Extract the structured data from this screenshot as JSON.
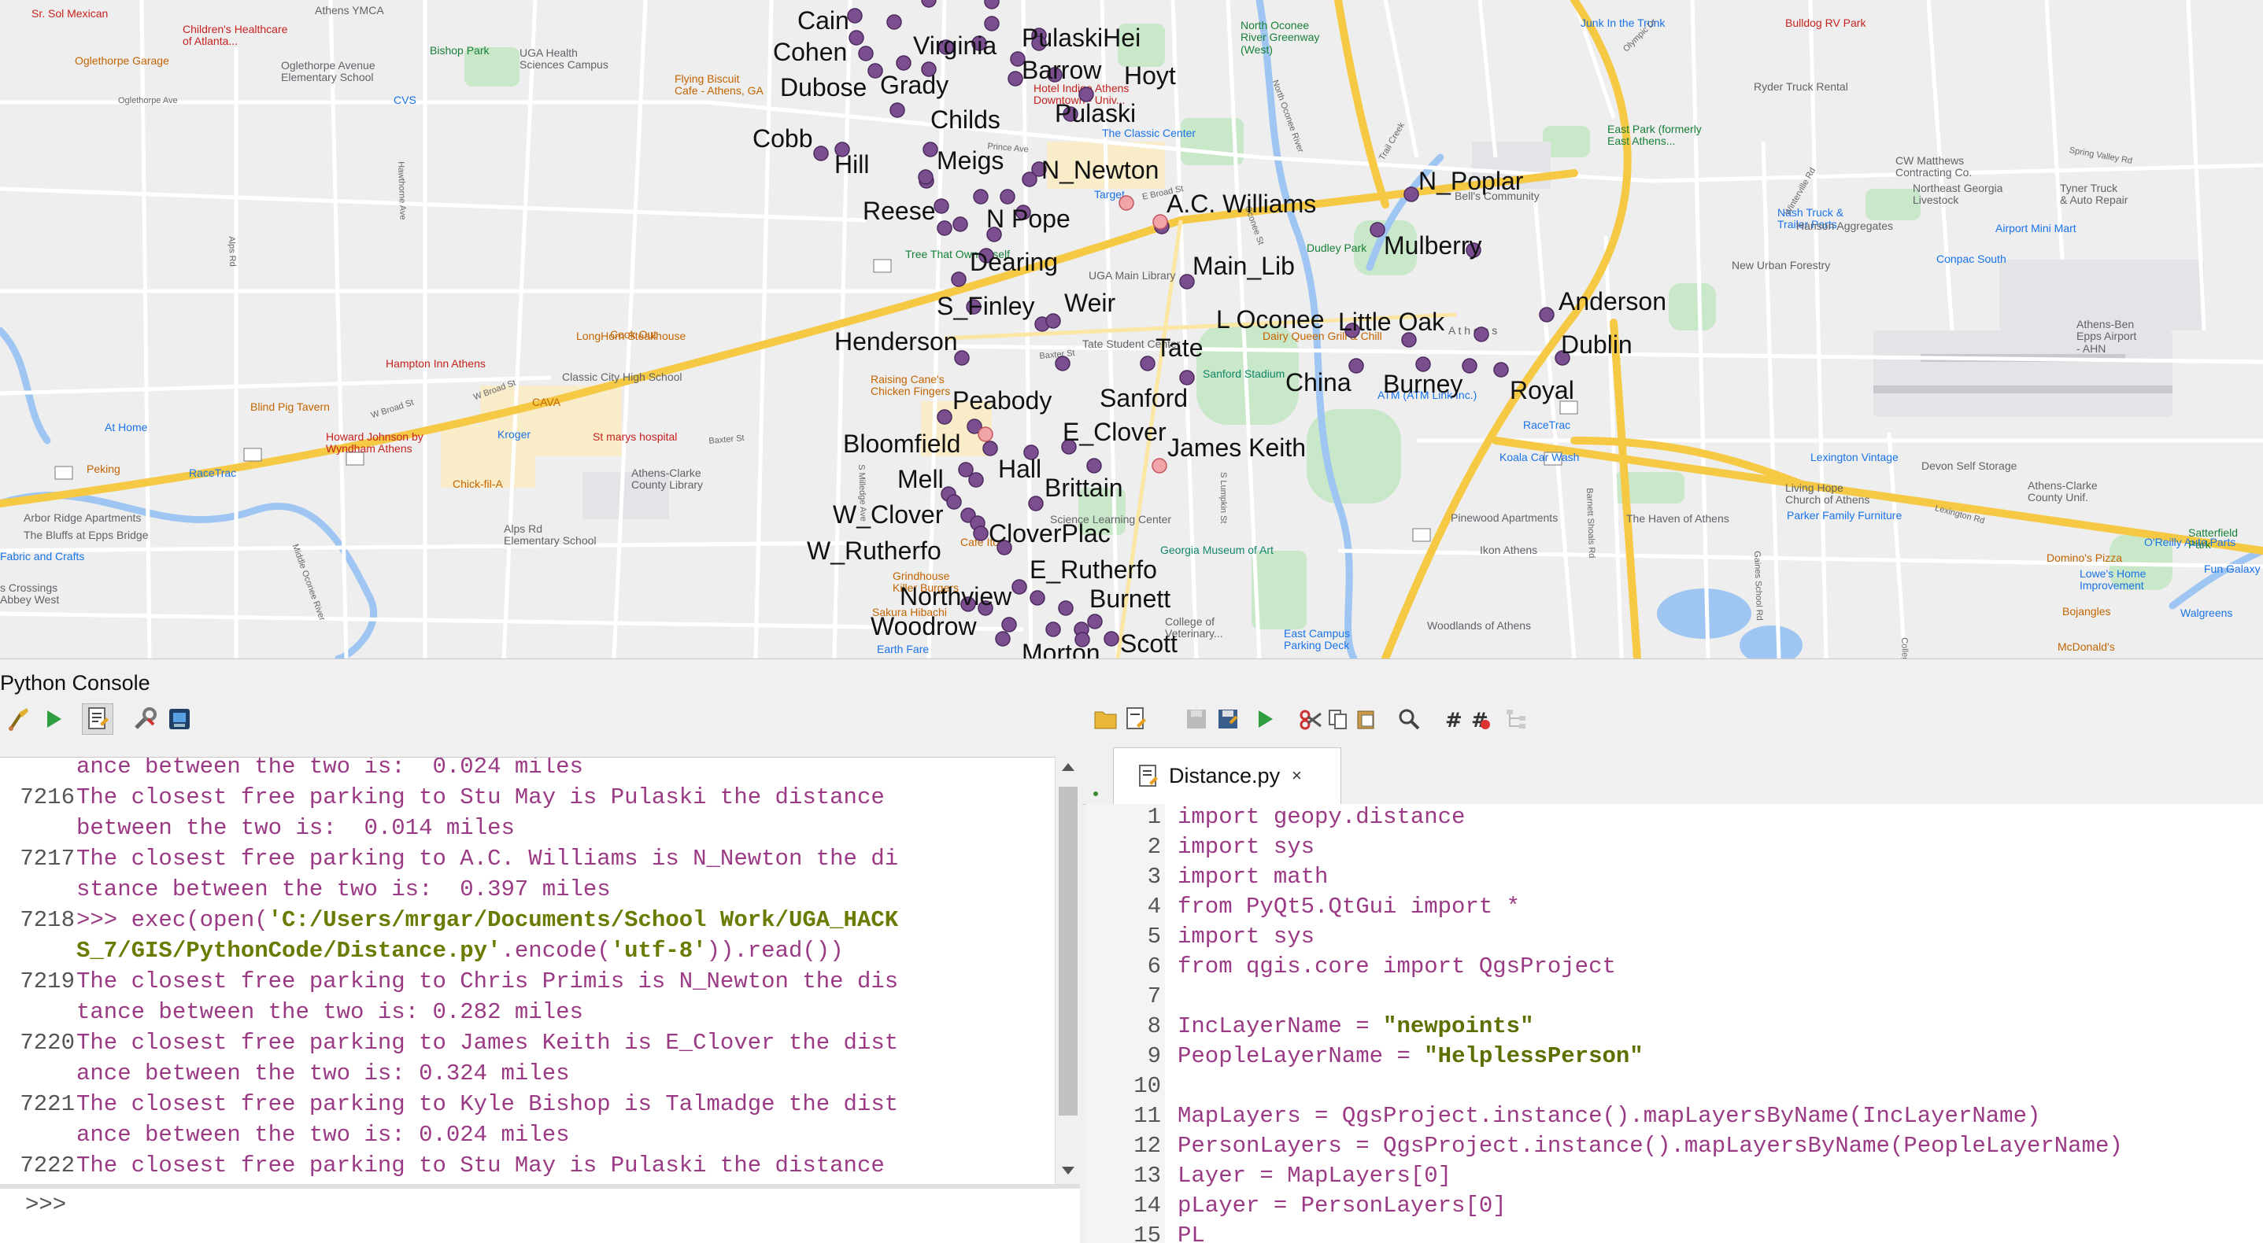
{
  "map": {
    "parking_labels": [
      {
        "id": "cain",
        "text": "Cain"
      },
      {
        "id": "cohen",
        "text": "Cohen"
      },
      {
        "id": "virginia",
        "text": "Virginia"
      },
      {
        "id": "pulaski-hei",
        "text": "PulaskiHei"
      },
      {
        "id": "barrow",
        "text": "Barrow"
      },
      {
        "id": "hoyt",
        "text": "Hoyt"
      },
      {
        "id": "dubose",
        "text": "Dubose"
      },
      {
        "id": "grady",
        "text": "Grady"
      },
      {
        "id": "childs",
        "text": "Childs"
      },
      {
        "id": "pulaski",
        "text": "Pulaski"
      },
      {
        "id": "cobb",
        "text": "Cobb"
      },
      {
        "id": "hill",
        "text": "Hill"
      },
      {
        "id": "meigs",
        "text": "Meigs"
      },
      {
        "id": "n-newton",
        "text": "N_Newton"
      },
      {
        "id": "ac-williams",
        "text": "A.C. Williams"
      },
      {
        "id": "reese",
        "text": "Reese"
      },
      {
        "id": "n-pope",
        "text": "N Pope"
      },
      {
        "id": "dearing",
        "text": "Dearing"
      },
      {
        "id": "main-lib",
        "text": "Main_Lib"
      },
      {
        "id": "s-finley",
        "text": "S_Finley"
      },
      {
        "id": "weir",
        "text": "Weir"
      },
      {
        "id": "henderson",
        "text": "Henderson"
      },
      {
        "id": "tate",
        "text": "Tate"
      },
      {
        "id": "l-oconee",
        "text": "L Oconee"
      },
      {
        "id": "little-oak",
        "text": "Little Oak"
      },
      {
        "id": "peabody",
        "text": "Peabody"
      },
      {
        "id": "sanford",
        "text": "Sanford"
      },
      {
        "id": "china",
        "text": "China"
      },
      {
        "id": "burney",
        "text": "Burney"
      },
      {
        "id": "royal",
        "text": "Royal"
      },
      {
        "id": "anderson",
        "text": "Anderson"
      },
      {
        "id": "dublin",
        "text": "Dublin"
      },
      {
        "id": "n-poplar",
        "text": "N_Poplar"
      },
      {
        "id": "mulberry",
        "text": "Mulberry"
      },
      {
        "id": "bloomfield",
        "text": "Bloomfield"
      },
      {
        "id": "e-clover",
        "text": "E_Clover"
      },
      {
        "id": "james-keith",
        "text": "James Keith"
      },
      {
        "id": "mell",
        "text": "Mell"
      },
      {
        "id": "hall",
        "text": "Hall"
      },
      {
        "id": "brittain",
        "text": "Brittain"
      },
      {
        "id": "w-clover",
        "text": "W_Clover"
      },
      {
        "id": "cloverplac",
        "text": "CloverPlac"
      },
      {
        "id": "w-rutherfo",
        "text": "W_Rutherfo"
      },
      {
        "id": "e-rutherfo",
        "text": "E_Rutherfo"
      },
      {
        "id": "northview",
        "text": "Northview"
      },
      {
        "id": "burnett",
        "text": "Burnett"
      },
      {
        "id": "woodrow",
        "text": "Woodrow"
      },
      {
        "id": "morton",
        "text": "Morton"
      },
      {
        "id": "scott",
        "text": "Scott"
      }
    ],
    "pois": [
      {
        "id": "sr-sol",
        "text": "Sr. Sol Mexican",
        "c": "red"
      },
      {
        "id": "childrens",
        "text": "Children's Healthcare\nof Atlanta...",
        "c": "red"
      },
      {
        "id": "athens-ymca",
        "text": "Athens YMCA",
        "c": "grey"
      },
      {
        "id": "oglethorpe-garage",
        "text": "Oglethorpe Garage",
        "c": "orange"
      },
      {
        "id": "oglethorpe-elem",
        "text": "Oglethorpe Avenue\nElementary School",
        "c": "grey"
      },
      {
        "id": "bishop-park",
        "text": "Bishop Park",
        "c": "green"
      },
      {
        "id": "uga-health",
        "text": "UGA Health\nSciences Campus",
        "c": "grey"
      },
      {
        "id": "flying-biscuit",
        "text": "Flying Biscuit\nCafe - Athens, GA",
        "c": "orange"
      },
      {
        "id": "cvs",
        "text": "CVS",
        "c": "blue"
      },
      {
        "id": "hotel-indigo",
        "text": "Hotel Indigo Athens\nDowntown - Univ...",
        "c": "red"
      },
      {
        "id": "classic-center",
        "text": "The Classic Center",
        "c": "blue"
      },
      {
        "id": "north-oconee",
        "text": "North Oconee\nRiver Greenway\n(West)",
        "c": "green"
      },
      {
        "id": "junk-trunk",
        "text": "Junk In the Trunk",
        "c": "blue"
      },
      {
        "id": "bulldog-rv",
        "text": "Bulldog RV Park",
        "c": "red"
      },
      {
        "id": "ryder",
        "text": "Ryder Truck Rental",
        "c": "grey"
      },
      {
        "id": "east-park",
        "text": "East Park (formerly\nEast Athens...",
        "c": "green"
      },
      {
        "id": "cw-matthews",
        "text": "CW Matthews\nContracting Co.",
        "c": "grey"
      },
      {
        "id": "northeast-livestock",
        "text": "Northeast Georgia\nLivestock",
        "c": "grey"
      },
      {
        "id": "tyner",
        "text": "Tyner Truck\n& Auto Repair",
        "c": "grey"
      },
      {
        "id": "nash-truck",
        "text": "Nash Truck &\nTrailer Parts",
        "c": "blue"
      },
      {
        "id": "hanson",
        "text": "Hanson Aggregates",
        "c": "grey"
      },
      {
        "id": "airport-mini",
        "text": "Airport Mini Mart",
        "c": "blue"
      },
      {
        "id": "conpac",
        "text": "Conpac South",
        "c": "blue"
      },
      {
        "id": "ne-forestry",
        "text": "New Urban Forestry",
        "c": "grey"
      },
      {
        "id": "ben-epps",
        "text": "Athens-Ben\nEpps Airport\n- AHN",
        "c": "grey"
      },
      {
        "id": "bell-community",
        "text": "Bell's Community",
        "c": "grey"
      },
      {
        "id": "dudley-park",
        "text": "Dudley Park",
        "c": "green"
      },
      {
        "id": "target",
        "text": "Target",
        "c": "blue"
      },
      {
        "id": "tree-that-owns",
        "text": "Tree That Owns Itself",
        "c": "green"
      },
      {
        "id": "uga-main-library",
        "text": "UGA Main Library",
        "c": "grey"
      },
      {
        "id": "longhorn",
        "text": "LongHorn Steakhouse",
        "c": "orange"
      },
      {
        "id": "cook-out",
        "text": "Cook Out",
        "c": "orange"
      },
      {
        "id": "hampton",
        "text": "Hampton Inn Athens",
        "c": "red"
      },
      {
        "id": "classic-city-hs",
        "text": "Classic City High School",
        "c": "grey"
      },
      {
        "id": "raising-canes",
        "text": "Raising Cane's\nChicken Fingers",
        "c": "orange"
      },
      {
        "id": "tate-student",
        "text": "Tate Student Center",
        "c": "grey"
      },
      {
        "id": "sanford-stadium",
        "text": "Sanford Stadium",
        "c": "teal"
      },
      {
        "id": "dairy-queen",
        "text": "Dairy Queen Grill & Chill",
        "c": "orange"
      },
      {
        "id": "blind-pig",
        "text": "Blind Pig Tavern",
        "c": "orange"
      },
      {
        "id": "cava",
        "text": "CAVA",
        "c": "orange"
      },
      {
        "id": "at-home",
        "text": "At Home",
        "c": "blue"
      },
      {
        "id": "kroger",
        "text": "Kroger",
        "c": "blue"
      },
      {
        "id": "st-marys",
        "text": "St marys hospital",
        "c": "red"
      },
      {
        "id": "howard-johnson",
        "text": "Howard Johnson by\nWyndham Athens",
        "c": "red"
      },
      {
        "id": "peking",
        "text": "Peking",
        "c": "orange"
      },
      {
        "id": "racetrac1",
        "text": "RaceTrac",
        "c": "blue"
      },
      {
        "id": "chick-fil-a",
        "text": "Chick-fil-A",
        "c": "orange"
      },
      {
        "id": "clarke-library",
        "text": "Athens-Clarke\nCounty Library",
        "c": "grey"
      },
      {
        "id": "alps-rd",
        "text": "Alps Rd\nElementary School",
        "c": "grey"
      },
      {
        "id": "arbor-ridge",
        "text": "Arbor Ridge Apartments",
        "c": "grey"
      },
      {
        "id": "bluffs",
        "text": "The Bluffs at Epps Bridge",
        "c": "grey"
      },
      {
        "id": "fabric",
        "text": "Fabric and Crafts",
        "c": "blue"
      },
      {
        "id": "crossings",
        "text": "s Crossings\nAbbey West",
        "c": "grey"
      },
      {
        "id": "atm",
        "text": "ATM (ATM Link Inc.)",
        "c": "blue"
      },
      {
        "id": "racetrac2",
        "text": "RaceTrac",
        "c": "blue"
      },
      {
        "id": "koala",
        "text": "Koala Car Wash",
        "c": "blue"
      },
      {
        "id": "lexington-vintage",
        "text": "Lexington Vintage",
        "c": "blue"
      },
      {
        "id": "devon",
        "text": "Devon Self Storage",
        "c": "grey"
      },
      {
        "id": "living-hope",
        "text": "Living Hope\nChurch of Athens",
        "c": "grey"
      },
      {
        "id": "clarke-unified",
        "text": "Athens-Clarke\nCounty Unif.",
        "c": "grey"
      },
      {
        "id": "parker-family",
        "text": "Parker Family Furniture",
        "c": "blue"
      },
      {
        "id": "haven",
        "text": "The Haven of Athens",
        "c": "grey"
      },
      {
        "id": "pinewood",
        "text": "Pinewood Apartments",
        "c": "grey"
      },
      {
        "id": "ikon",
        "text": "Ikon Athens",
        "c": "grey"
      },
      {
        "id": "satterfield",
        "text": "Satterfield\nPark",
        "c": "green"
      },
      {
        "id": "dominos",
        "text": "Domino's Pizza",
        "c": "orange"
      },
      {
        "id": "oreilly",
        "text": "O'Reilly Auto Parts",
        "c": "blue"
      },
      {
        "id": "lowes",
        "text": "Lowe's Home\nImprovement",
        "c": "blue"
      },
      {
        "id": "fun-galaxy",
        "text": "Fun Galaxy A...",
        "c": "blue"
      },
      {
        "id": "bojangles",
        "text": "Bojangles",
        "c": "orange"
      },
      {
        "id": "walgreens",
        "text": "Walgreens",
        "c": "blue"
      },
      {
        "id": "mcdonalds",
        "text": "McDonald's",
        "c": "orange"
      },
      {
        "id": "woodlands",
        "text": "Woodlands of Athens",
        "c": "grey"
      },
      {
        "id": "georgia-museum",
        "text": "Georgia Museum of Art",
        "c": "teal"
      },
      {
        "id": "science-learning",
        "text": "Science Learning Center",
        "c": "grey"
      },
      {
        "id": "east-campus",
        "text": "East Campus\nParking Deck",
        "c": "blue"
      },
      {
        "id": "college-vet",
        "text": "College of\nVeterinary...",
        "c": "grey"
      },
      {
        "id": "grindhouse",
        "text": "Grindhouse\nKiller Burgers",
        "c": "orange"
      },
      {
        "id": "sakura",
        "text": "Sakura Hibachi",
        "c": "orange"
      },
      {
        "id": "earth-fare",
        "text": "Earth Fare",
        "c": "blue"
      },
      {
        "id": "cafe-ito",
        "text": "Café Ito",
        "c": "orange"
      },
      {
        "id": "athens-text",
        "text": "A t h e n s",
        "c": "grey"
      }
    ],
    "streets": [
      {
        "id": "oglethorpe-ave",
        "text": "Oglethorpe Ave"
      },
      {
        "id": "w-broad",
        "text": "W Broad St"
      },
      {
        "id": "w-broad2",
        "text": "W Broad St"
      },
      {
        "id": "baxter",
        "text": "Baxter St"
      },
      {
        "id": "baxter2",
        "text": "Baxter St"
      },
      {
        "id": "prince",
        "text": "Prince Ave"
      },
      {
        "id": "milledge",
        "text": "S Milledge Ave"
      },
      {
        "id": "lumpkin",
        "text": "S Lumpkin St"
      },
      {
        "id": "e-broad",
        "text": "E Broad St"
      },
      {
        "id": "oconee-st",
        "text": "Oconee St"
      },
      {
        "id": "n-oconee-river",
        "text": "North Oconee River"
      },
      {
        "id": "middle-oconee",
        "text": "Middle Oconee River"
      },
      {
        "id": "trail-creek",
        "text": "Trail Creek"
      },
      {
        "id": "winterville",
        "text": "Winterville Rd"
      },
      {
        "id": "olympic",
        "text": "Olympic Dr"
      },
      {
        "id": "spring-valley",
        "text": "Spring Valley Rd"
      },
      {
        "id": "lexington",
        "text": "Lexington Rd"
      },
      {
        "id": "barnett",
        "text": "Barnett Shoals Rd"
      },
      {
        "id": "gaines",
        "text": "Gaines School Rd"
      },
      {
        "id": "college-station",
        "text": "College Station Rd"
      },
      {
        "id": "hawthorne",
        "text": "Hawthorne Ave"
      },
      {
        "id": "alps",
        "text": "Alps Rd"
      }
    ]
  },
  "console": {
    "title": "Python Console",
    "toolbar": [
      "clear-icon",
      "run-icon",
      "show-editor-icon",
      "options-icon",
      "help-icon"
    ],
    "history": [
      {
        "num": "",
        "text": "ance between the two is:  0.024 miles"
      },
      {
        "num": "7216",
        "text": "The closest free parking to Stu May is Pulaski the distance"
      },
      {
        "num": "",
        "text": "between the two is:  0.014 miles"
      },
      {
        "num": "7217",
        "text": "The closest free parking to A.C. Williams is N_Newton the di"
      },
      {
        "num": "",
        "text": "stance between the two is:  0.397 miles"
      },
      {
        "num": "7218",
        "text": ">>> exec(open(",
        "str": "'C:/Users/mrgar/Documents/School Work/UGA_HACK",
        "kind": "exec1"
      },
      {
        "num": "",
        "text": "",
        "str": "S_7/GIS/PythonCode/Distance.py'",
        "tail": ".encode(",
        "str2": "'utf-8'",
        "tail2": ")).read())",
        "kind": "exec2"
      },
      {
        "num": "7219",
        "text": "The closest free parking to Chris Primis is N_Newton the dis"
      },
      {
        "num": "",
        "text": "tance between the two is: 0.282 miles"
      },
      {
        "num": "7220",
        "text": "The closest free parking to James Keith is E_Clover the dist"
      },
      {
        "num": "",
        "text": "ance between the two is: 0.324 miles"
      },
      {
        "num": "7221",
        "text": "The closest free parking to Kyle Bishop is Talmadge the dist"
      },
      {
        "num": "",
        "text": "ance between the two is: 0.024 miles"
      },
      {
        "num": "7222",
        "text": "The closest free parking to Stu May is Pulaski the distance"
      }
    ],
    "prompt": ">>>"
  },
  "editor": {
    "tab_label": "Distance.py",
    "tab_close": "×",
    "lines": [
      {
        "n": "1",
        "parts": [
          [
            "import geopy.distance",
            ""
          ]
        ]
      },
      {
        "n": "2",
        "parts": [
          [
            "import sys",
            ""
          ]
        ]
      },
      {
        "n": "3",
        "parts": [
          [
            "import math",
            ""
          ]
        ]
      },
      {
        "n": "4",
        "parts": [
          [
            "from PyQt5.QtGui import *",
            ""
          ]
        ]
      },
      {
        "n": "5",
        "parts": [
          [
            "import sys",
            ""
          ]
        ]
      },
      {
        "n": "6",
        "parts": [
          [
            "from qgis.core import QgsProject",
            ""
          ]
        ]
      },
      {
        "n": "7",
        "parts": []
      },
      {
        "n": "8",
        "parts": [
          [
            "IncLayerName = ",
            ""
          ],
          [
            "\"newpoints\"",
            "s"
          ]
        ]
      },
      {
        "n": "9",
        "parts": [
          [
            "PeopleLayerName = ",
            ""
          ],
          [
            "\"HelplessPerson\"",
            "s"
          ]
        ]
      },
      {
        "n": "10",
        "parts": []
      },
      {
        "n": "11",
        "parts": [
          [
            "MapLayers = QgsProject.instance().mapLayersByName(IncLayerName)",
            ""
          ]
        ]
      },
      {
        "n": "12",
        "parts": [
          [
            "PersonLayers = QgsProject.instance().mapLayersByName(PeopleLayerName)",
            ""
          ]
        ]
      },
      {
        "n": "13",
        "parts": [
          [
            "Layer = MapLayers[0]",
            ""
          ]
        ]
      },
      {
        "n": "14",
        "parts": [
          [
            "pLayer = PersonLayers[0]",
            ""
          ]
        ]
      },
      {
        "n": "15",
        "parts": [
          [
            "PL        ",
            ""
          ]
        ]
      }
    ]
  }
}
